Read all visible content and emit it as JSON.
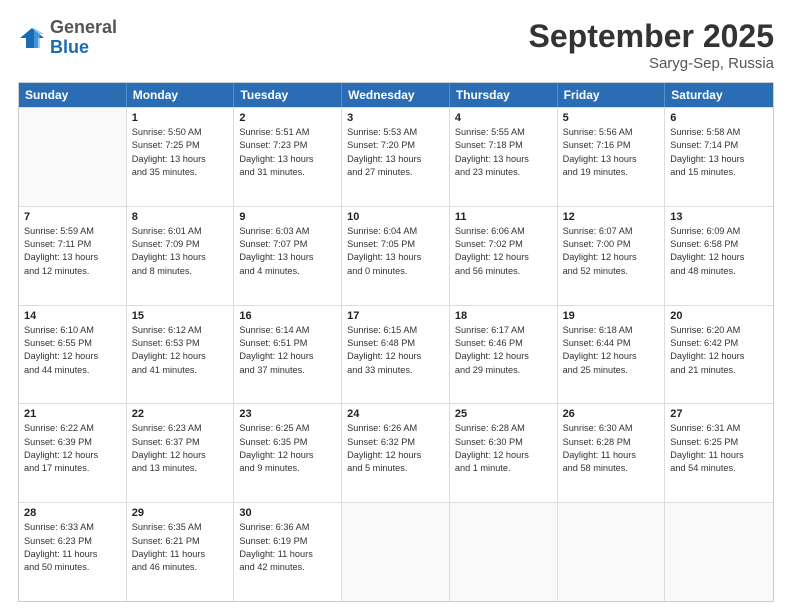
{
  "logo": {
    "general": "General",
    "blue": "Blue"
  },
  "header": {
    "month": "September 2025",
    "location": "Saryg-Sep, Russia"
  },
  "days": [
    "Sunday",
    "Monday",
    "Tuesday",
    "Wednesday",
    "Thursday",
    "Friday",
    "Saturday"
  ],
  "weeks": [
    [
      {
        "day": "",
        "info": ""
      },
      {
        "day": "1",
        "info": "Sunrise: 5:50 AM\nSunset: 7:25 PM\nDaylight: 13 hours\nand 35 minutes."
      },
      {
        "day": "2",
        "info": "Sunrise: 5:51 AM\nSunset: 7:23 PM\nDaylight: 13 hours\nand 31 minutes."
      },
      {
        "day": "3",
        "info": "Sunrise: 5:53 AM\nSunset: 7:20 PM\nDaylight: 13 hours\nand 27 minutes."
      },
      {
        "day": "4",
        "info": "Sunrise: 5:55 AM\nSunset: 7:18 PM\nDaylight: 13 hours\nand 23 minutes."
      },
      {
        "day": "5",
        "info": "Sunrise: 5:56 AM\nSunset: 7:16 PM\nDaylight: 13 hours\nand 19 minutes."
      },
      {
        "day": "6",
        "info": "Sunrise: 5:58 AM\nSunset: 7:14 PM\nDaylight: 13 hours\nand 15 minutes."
      }
    ],
    [
      {
        "day": "7",
        "info": "Sunrise: 5:59 AM\nSunset: 7:11 PM\nDaylight: 13 hours\nand 12 minutes."
      },
      {
        "day": "8",
        "info": "Sunrise: 6:01 AM\nSunset: 7:09 PM\nDaylight: 13 hours\nand 8 minutes."
      },
      {
        "day": "9",
        "info": "Sunrise: 6:03 AM\nSunset: 7:07 PM\nDaylight: 13 hours\nand 4 minutes."
      },
      {
        "day": "10",
        "info": "Sunrise: 6:04 AM\nSunset: 7:05 PM\nDaylight: 13 hours\nand 0 minutes."
      },
      {
        "day": "11",
        "info": "Sunrise: 6:06 AM\nSunset: 7:02 PM\nDaylight: 12 hours\nand 56 minutes."
      },
      {
        "day": "12",
        "info": "Sunrise: 6:07 AM\nSunset: 7:00 PM\nDaylight: 12 hours\nand 52 minutes."
      },
      {
        "day": "13",
        "info": "Sunrise: 6:09 AM\nSunset: 6:58 PM\nDaylight: 12 hours\nand 48 minutes."
      }
    ],
    [
      {
        "day": "14",
        "info": "Sunrise: 6:10 AM\nSunset: 6:55 PM\nDaylight: 12 hours\nand 44 minutes."
      },
      {
        "day": "15",
        "info": "Sunrise: 6:12 AM\nSunset: 6:53 PM\nDaylight: 12 hours\nand 41 minutes."
      },
      {
        "day": "16",
        "info": "Sunrise: 6:14 AM\nSunset: 6:51 PM\nDaylight: 12 hours\nand 37 minutes."
      },
      {
        "day": "17",
        "info": "Sunrise: 6:15 AM\nSunset: 6:48 PM\nDaylight: 12 hours\nand 33 minutes."
      },
      {
        "day": "18",
        "info": "Sunrise: 6:17 AM\nSunset: 6:46 PM\nDaylight: 12 hours\nand 29 minutes."
      },
      {
        "day": "19",
        "info": "Sunrise: 6:18 AM\nSunset: 6:44 PM\nDaylight: 12 hours\nand 25 minutes."
      },
      {
        "day": "20",
        "info": "Sunrise: 6:20 AM\nSunset: 6:42 PM\nDaylight: 12 hours\nand 21 minutes."
      }
    ],
    [
      {
        "day": "21",
        "info": "Sunrise: 6:22 AM\nSunset: 6:39 PM\nDaylight: 12 hours\nand 17 minutes."
      },
      {
        "day": "22",
        "info": "Sunrise: 6:23 AM\nSunset: 6:37 PM\nDaylight: 12 hours\nand 13 minutes."
      },
      {
        "day": "23",
        "info": "Sunrise: 6:25 AM\nSunset: 6:35 PM\nDaylight: 12 hours\nand 9 minutes."
      },
      {
        "day": "24",
        "info": "Sunrise: 6:26 AM\nSunset: 6:32 PM\nDaylight: 12 hours\nand 5 minutes."
      },
      {
        "day": "25",
        "info": "Sunrise: 6:28 AM\nSunset: 6:30 PM\nDaylight: 12 hours\nand 1 minute."
      },
      {
        "day": "26",
        "info": "Sunrise: 6:30 AM\nSunset: 6:28 PM\nDaylight: 11 hours\nand 58 minutes."
      },
      {
        "day": "27",
        "info": "Sunrise: 6:31 AM\nSunset: 6:25 PM\nDaylight: 11 hours\nand 54 minutes."
      }
    ],
    [
      {
        "day": "28",
        "info": "Sunrise: 6:33 AM\nSunset: 6:23 PM\nDaylight: 11 hours\nand 50 minutes."
      },
      {
        "day": "29",
        "info": "Sunrise: 6:35 AM\nSunset: 6:21 PM\nDaylight: 11 hours\nand 46 minutes."
      },
      {
        "day": "30",
        "info": "Sunrise: 6:36 AM\nSunset: 6:19 PM\nDaylight: 11 hours\nand 42 minutes."
      },
      {
        "day": "",
        "info": ""
      },
      {
        "day": "",
        "info": ""
      },
      {
        "day": "",
        "info": ""
      },
      {
        "day": "",
        "info": ""
      }
    ]
  ]
}
